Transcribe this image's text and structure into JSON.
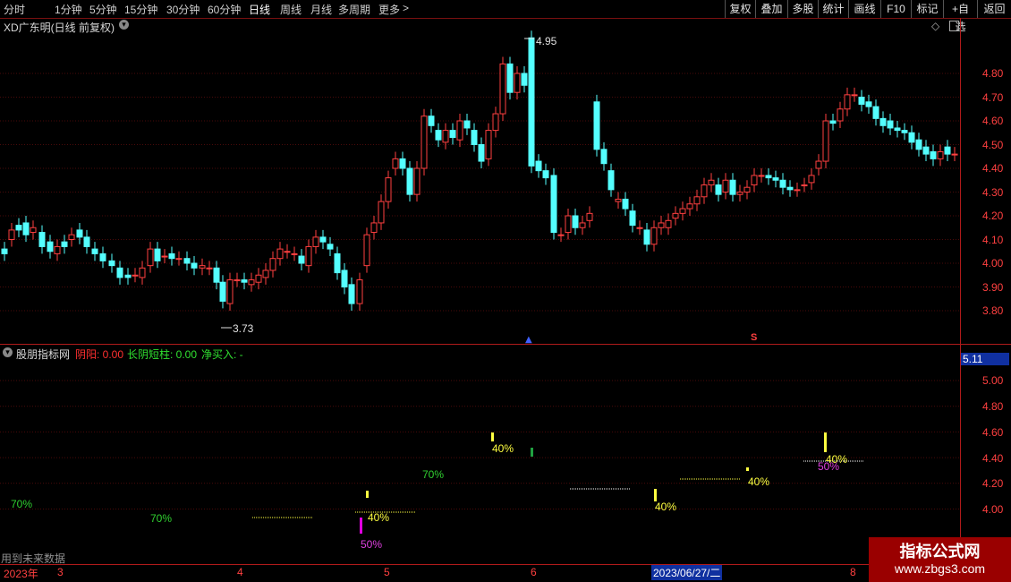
{
  "toolbar": {
    "periods": [
      "分时",
      "1分钟",
      "5分钟",
      "15分钟",
      "30分钟",
      "60分钟",
      "日线",
      "周线",
      "月线",
      "多周期",
      "更多"
    ],
    "active_period": "日线",
    "more_arrow": ">",
    "right_buttons": [
      "复权",
      "叠加",
      "多股",
      "统计",
      "画线",
      "F10",
      "标记",
      "+自选",
      "返回"
    ]
  },
  "main_chart": {
    "title": "XD广东明(日线 前复权)",
    "high_label": "4.95",
    "low_label": "3.73",
    "price_ticks": [
      "4.80",
      "4.70",
      "4.60",
      "4.50",
      "4.40",
      "4.30",
      "4.20",
      "4.10",
      "4.00",
      "3.90",
      "3.80"
    ],
    "marker_s": "S"
  },
  "indicator": {
    "name": "股朋指标网",
    "items": [
      {
        "label": "阴阳: 0.00",
        "color": "#ff3030"
      },
      {
        "label": "长阴短柱: 0.00",
        "color": "#30e030"
      },
      {
        "label": "净买入: -",
        "color": "#30e030"
      }
    ],
    "current_value": "5.11",
    "ticks": [
      "5.00",
      "4.80",
      "4.60",
      "4.40",
      "4.20",
      "4.00"
    ],
    "pct_labels": [
      {
        "text": "70%",
        "color": "#30d030"
      },
      {
        "text": "70%",
        "color": "#30d030"
      },
      {
        "text": "70%",
        "color": "#30d030"
      },
      {
        "text": "40%",
        "color": "#ffff40"
      },
      {
        "text": "50%",
        "color": "#e040e0"
      },
      {
        "text": "40%",
        "color": "#ffff40"
      },
      {
        "text": "40%",
        "color": "#ffff40"
      },
      {
        "text": "40%",
        "color": "#ffff40"
      },
      {
        "text": "40%",
        "color": "#ffff40"
      },
      {
        "text": "50%",
        "color": "#e040e0"
      }
    ],
    "footer_note": "用到未来数据"
  },
  "date_axis": {
    "labels": [
      "2023年",
      "3",
      "4",
      "5",
      "6",
      "2023/06/27/二",
      "8"
    ]
  },
  "watermark": {
    "line1": "指标公式网",
    "line2": "www.zbgs3.com"
  },
  "colors": {
    "up": "#ff4040",
    "down": "#54ffff",
    "grid": "#7a1010",
    "axis": "#b01a1a"
  }
}
